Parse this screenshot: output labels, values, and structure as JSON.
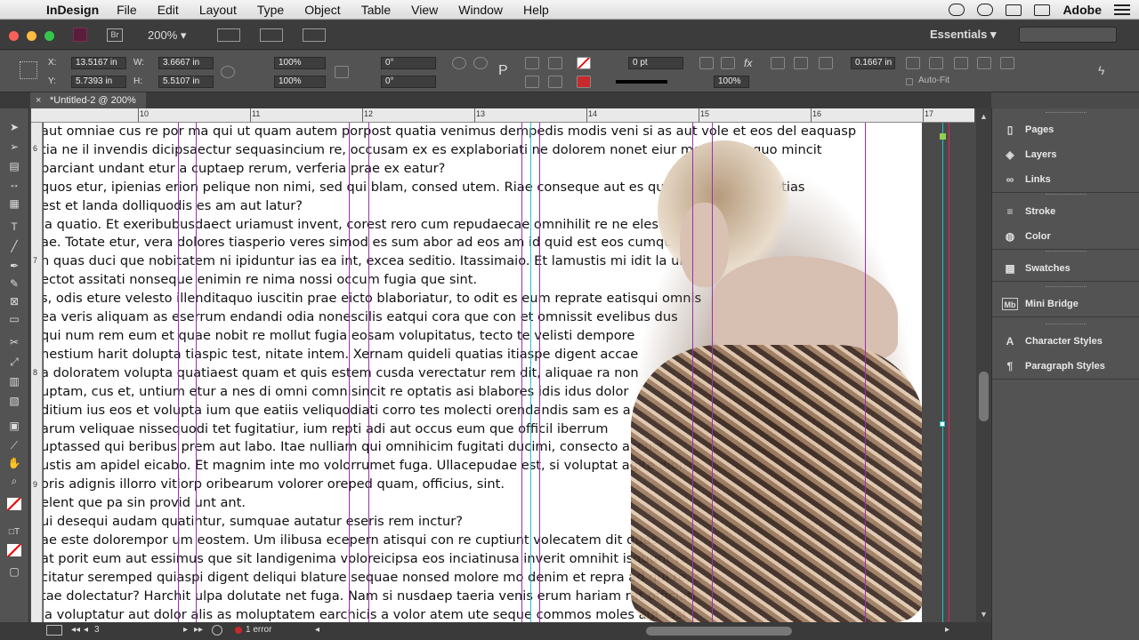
{
  "menubar": {
    "app_name": "InDesign",
    "menus": [
      "File",
      "Edit",
      "Layout",
      "Type",
      "Object",
      "Table",
      "View",
      "Window",
      "Help"
    ],
    "right_label": "Adobe"
  },
  "appbar": {
    "bridge_label": "Br",
    "zoom_level": "200%",
    "workspace": "Essentials",
    "search_placeholder": ""
  },
  "control": {
    "x_label": "X:",
    "x_value": "13.5167 in",
    "y_label": "Y:",
    "y_value": "5.7393 in",
    "w_label": "W:",
    "w_value": "3.6667 in",
    "h_label": "H:",
    "h_value": "5.5107 in",
    "scale_x": "100%",
    "scale_y": "100%",
    "rotate": "0°",
    "shear": "0°",
    "stroke_weight": "0 pt",
    "opacity": "100%",
    "gap_value": "0.1667 in",
    "autofit_label": "Auto-Fit"
  },
  "document": {
    "tab_title": "*Untitled-2 @ 200%"
  },
  "ruler": {
    "top_numbers": [
      "10",
      "11",
      "12",
      "13",
      "14",
      "15",
      "16",
      "17"
    ],
    "left_numbers": [
      "6",
      "7",
      "8",
      "9"
    ]
  },
  "copy_lines": [
    "aut omniae cus re por ma qui ut quam autem porpost quatia venimus dempedis modis veni si as aut vole et eos del eaquasp",
    "tia ne il invendis dicipsaectur sequasincium re, occusam ex es explaboriati ne dolorem nonet eiur mo berrumquo mincit",
    "parciant undant etur a cuptaep rerum, verferia prae ex eatur?",
    "quos etur, ipienias erion pelique non nimi, sed qui blam, consed utem. Riae conseque aut es qui ab imus. Soloruptias",
    "est et landa dolliquodis es am aut latur?",
    "ia quatio. Et exeribubusdaect uriamust invent, corest rero cum repudaecae omnihilit re ne eleste et dolo conse",
    "ae. Totate etur, vera dolores tiasperio veres simod es sum abor ad eos am id quid est eos cumqui temo mossus",
    "n quas duci que nobitatem ni ipiduntur ias ea int, excea seditio. Itassimaio. Et lamustis mi idit la unt etitio",
    "ectot assitati nonseque enimin re nima nossi occum fugia que sint.",
    "s, odis eture velesto illenditaquo iuscitin prae eicto blaboriatur, to odit es eum reprate eatisqui omnis",
    "ea veris aliquam as eserrum endandi odia nonescilis eatqui cora que con et omnissit evelibus dus",
    " qui num rem eum et quae nobit re mollut fugia eosam volupitatus, tecto te velisti dempore",
    "nestium harit dolupta tiaspic test, nitate intem. Xernam quideli quatias itiaspe digent accae",
    "a doloratem volupta quatiaest quam et quis estem cusda verectatur rem dit, aliquae ra non",
    "uptam, cus et, untium etur a nes di omni comnisincit re optatis asi blabores idis idus dolor",
    "ditium ius eos et volupta ium que eatiis veliquodiati corro tes molecti orendandis sam es a",
    "arum veliquae nissequodi tet fugitatiur, ium repti adi aut occus eum que officil iberrum",
    "uptassed qui beribus prem aut labo. Itae nulliam qui omnihicim fugitati ducimi, consecto accust",
    "ustis am apidel eicabo. Et magnim inte mo volorrumet fuga. Ullacepudae est, si voluptat agite dion",
    "oris adignis illorro vitiorp oribearum volorer oreped quam, officius, sint.",
    "elent que pa sin provid unt ant.",
    "ui desequi audam quatintur, sumquae autatur eseris rem inctur?",
    "ae este dolorempor um eostem. Um ilibusa ecepern atisqui con re cuptiunt volecatem dit quas",
    "at porit eum aut essimus que sit landigenima voloreicipsa eos inciatinusa inverit omnihit isquunt re",
    "citatur seremped quiaspi digent deliqui blature sequae nonsed molore mo denim et repra ad qui re, s",
    "tae dolectatur? Harchit ulpa dolutate net fuga. Nam si nusdaep taeria venis erum hariam rat officiati",
    "ia voluptatur aut dolor alis as moluptatem earchicis a volor atem ute seque commos moles aut lasi"
  ],
  "panels": [
    {
      "label": "Pages",
      "icon": "pages-icon"
    },
    {
      "label": "Layers",
      "icon": "layers-icon"
    },
    {
      "label": "Links",
      "icon": "links-icon"
    },
    {
      "label": "Stroke",
      "icon": "stroke-icon"
    },
    {
      "label": "Color",
      "icon": "color-icon"
    },
    {
      "label": "Swatches",
      "icon": "swatches-icon"
    },
    {
      "label": "Mini Bridge",
      "icon": "mini-bridge-icon"
    },
    {
      "label": "Character Styles",
      "icon": "character-styles-icon"
    },
    {
      "label": "Paragraph Styles",
      "icon": "paragraph-styles-icon"
    }
  ],
  "status": {
    "page_number": "3",
    "preflight": "1 error"
  },
  "colors": {
    "guide_magenta": "#9b2fae",
    "guide_cyan": "#1fc6ce",
    "bleed_red": "#e0245e",
    "traffic_red": "#fc605b",
    "traffic_yellow": "#fdbc40",
    "traffic_green": "#34c84a"
  }
}
